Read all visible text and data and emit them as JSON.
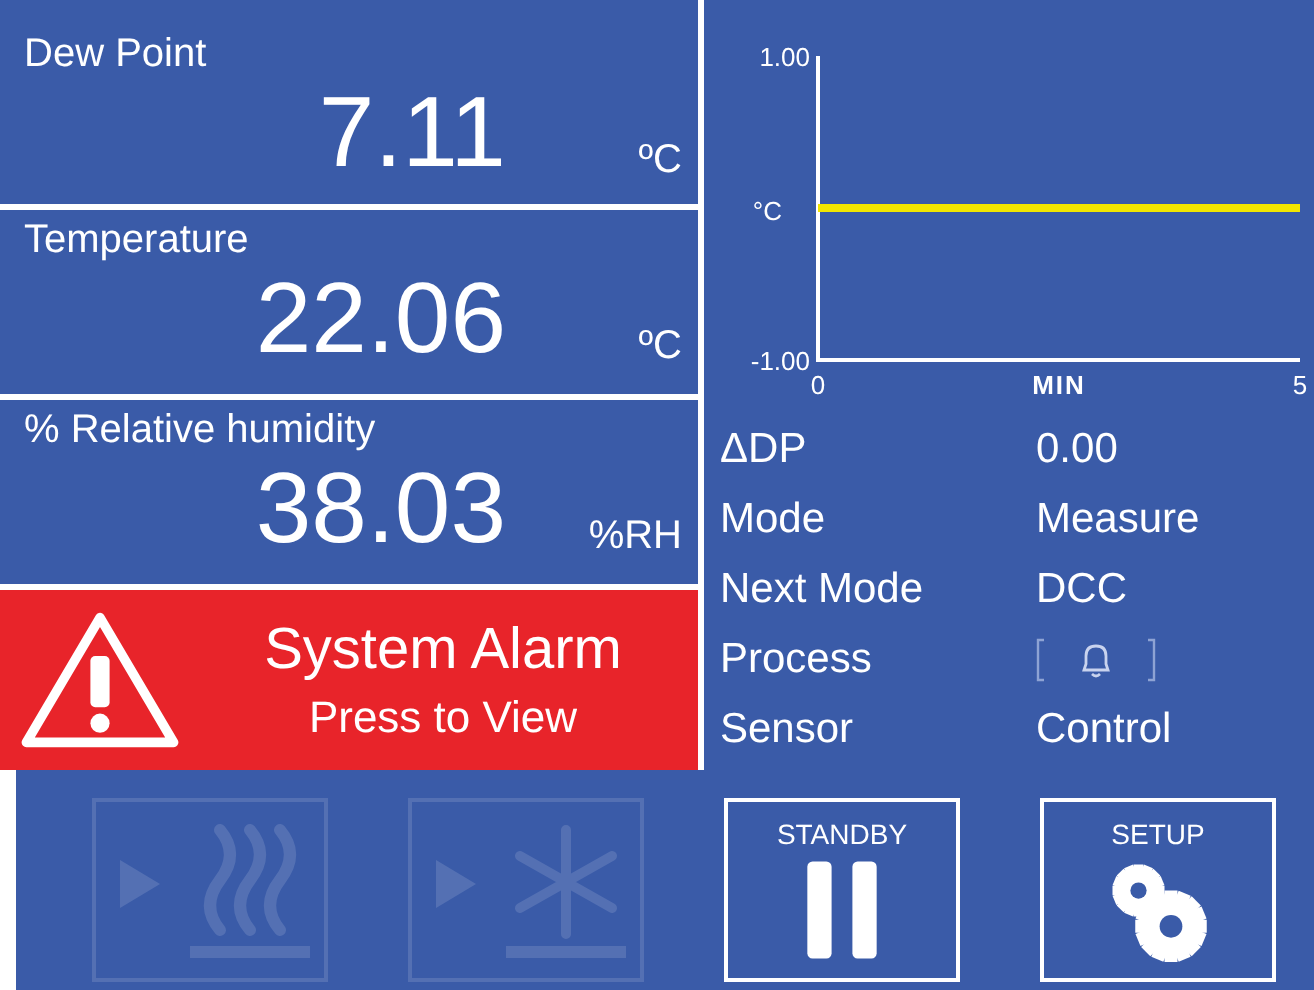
{
  "readings": [
    {
      "label": "Dew Point",
      "value": "7.11",
      "unit": "ºC"
    },
    {
      "label": "Temperature",
      "value": "22.06",
      "unit": "ºC"
    },
    {
      "label": "% Relative humidity",
      "value": "38.03",
      "unit": "%RH"
    }
  ],
  "alarm": {
    "title": "System Alarm",
    "subtitle": "Press to View"
  },
  "chart": {
    "chart_data": {
      "type": "line",
      "xlabel": "MIN",
      "ylabel": "°C",
      "x": [
        0,
        5
      ],
      "series": [
        {
          "color": "#f2e600",
          "values": [
            0,
            0
          ]
        }
      ],
      "xlim": [
        0,
        5
      ],
      "ylim": [
        -1,
        1
      ],
      "xticks": [
        0,
        5
      ],
      "yticks": [
        {
          "value": -1,
          "label": "-1.00"
        },
        {
          "value": 1,
          "label": "1.00"
        }
      ]
    }
  },
  "status": [
    {
      "label": "ΔDP",
      "kind": "text",
      "value": "0.00"
    },
    {
      "label": "Mode",
      "kind": "text",
      "value": "Measure"
    },
    {
      "label": "Next Mode",
      "kind": "text",
      "value": "DCC"
    },
    {
      "label": "Process",
      "kind": "bell"
    },
    {
      "label": "Sensor",
      "kind": "text",
      "value": "Control"
    }
  ],
  "buttons": [
    {
      "kind": "heat",
      "disabled": true
    },
    {
      "kind": "cool",
      "disabled": true
    },
    {
      "kind": "pause",
      "label": "STANDBY",
      "disabled": false
    },
    {
      "kind": "gears",
      "label": "SETUP",
      "disabled": false
    }
  ]
}
